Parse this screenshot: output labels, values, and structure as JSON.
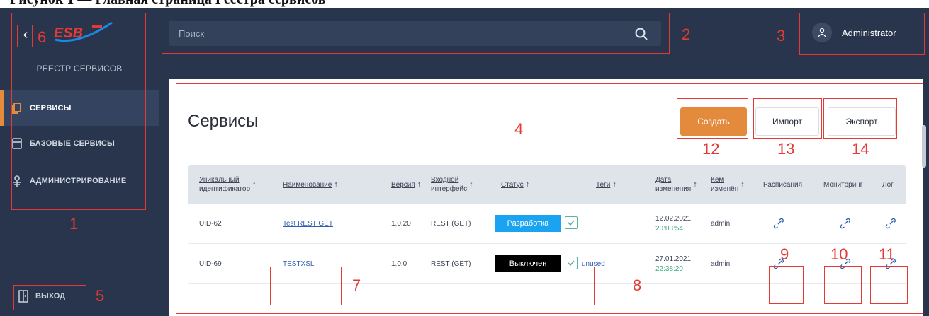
{
  "doc_title": "Рисунок 1 — Главная страница Реестра сервисов",
  "sidebar": {
    "registry_title": "РЕЕСТР СЕРВИСОВ",
    "items": [
      {
        "label": "СЕРВИСЫ",
        "active": true
      },
      {
        "label": "БАЗОВЫЕ СЕРВИСЫ",
        "active": false
      },
      {
        "label": "АДМИНИСТРИРОВАНИЕ",
        "active": false
      }
    ],
    "logout_label": "ВЫХОД"
  },
  "search": {
    "placeholder": "Поиск"
  },
  "user": {
    "name": "Administrator"
  },
  "main": {
    "title": "Сервисы",
    "create_label": "Создать",
    "import_label": "Импорт",
    "export_label": "Экспорт"
  },
  "table": {
    "columns": {
      "uid_1": "Уникальный",
      "uid_2": "идентификатор",
      "name": "Наименование",
      "version": "Версия",
      "iface_1": "Входной",
      "iface_2": "интерфейс",
      "status": "Статус",
      "tags": "Теги",
      "date_1": "Дата",
      "date_2": "изменения",
      "by_1": "Кем",
      "by_2": "изменён",
      "schedule": "Расписания",
      "monitoring": "Мониторинг",
      "log": "Лог"
    },
    "rows": [
      {
        "uid": "UID-62",
        "name": "Test REST GET",
        "version": "1.0.20",
        "iface": "REST (GET)",
        "status": "Разработка",
        "status_color": "#1aa3f0",
        "tag": "",
        "date": "12.02.2021",
        "time": "20:03:54",
        "by": "admin"
      },
      {
        "uid": "UID-69",
        "name": "TESTXSL",
        "version": "1.0.0",
        "iface": "REST (GET)",
        "status": "Выключен",
        "status_color": "#000000",
        "tag": "unused",
        "date": "27.01.2021",
        "time": "22:38:20",
        "by": "admin"
      }
    ]
  },
  "annotations": {
    "n1": "1",
    "n2": "2",
    "n3": "3",
    "n4": "4",
    "n5": "5",
    "n6": "6",
    "n7": "7",
    "n8": "8",
    "n9": "9",
    "n10": "10",
    "n11": "11",
    "n12": "12",
    "n13": "13",
    "n14": "14"
  },
  "colors": {
    "sidebar": "#28354c",
    "accent": "#e38a3d",
    "link": "#2f5fae",
    "annotation": "#e53935"
  }
}
